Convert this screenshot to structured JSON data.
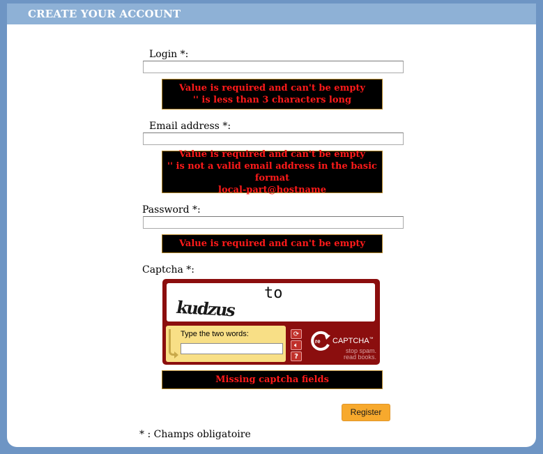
{
  "header": {
    "title": "CREATE YOUR ACCOUNT"
  },
  "form": {
    "login": {
      "label": "Login *:",
      "value": "",
      "errors": [
        "Value is required and can't be empty",
        "'' is less than 3 characters long"
      ]
    },
    "email": {
      "label": "Email address *:",
      "value": "",
      "errors": [
        "Value is required and can't be empty",
        "'' is not a valid email address in the basic format",
        "local-part@hostname"
      ]
    },
    "password": {
      "label": "Password *:",
      "value": "",
      "errors": [
        "Value is required and can't be empty"
      ]
    },
    "captcha": {
      "label": "Captcha *:",
      "word1": "kudzus",
      "word2": "to",
      "prompt": "Type the two words:",
      "value": "",
      "brand_prefix": "re",
      "brand_name": "CAPTCHA",
      "brand_tm": "™",
      "tagline_1": "stop spam.",
      "tagline_2": "read books.",
      "refresh_icon": "refresh-icon",
      "audio_icon": "audio-icon",
      "help_icon": "help-icon",
      "error": "Missing captcha fields"
    },
    "register_label": "Register",
    "footnote": "* : Champs obligatoire"
  },
  "colors": {
    "page_bg": "#6e95c4",
    "header_bg": "#8eb1d6",
    "error_text": "#ff1a1a",
    "error_bg": "#000000",
    "captcha_bg": "#8b0e0e",
    "button_bg": "#f7a92d"
  }
}
